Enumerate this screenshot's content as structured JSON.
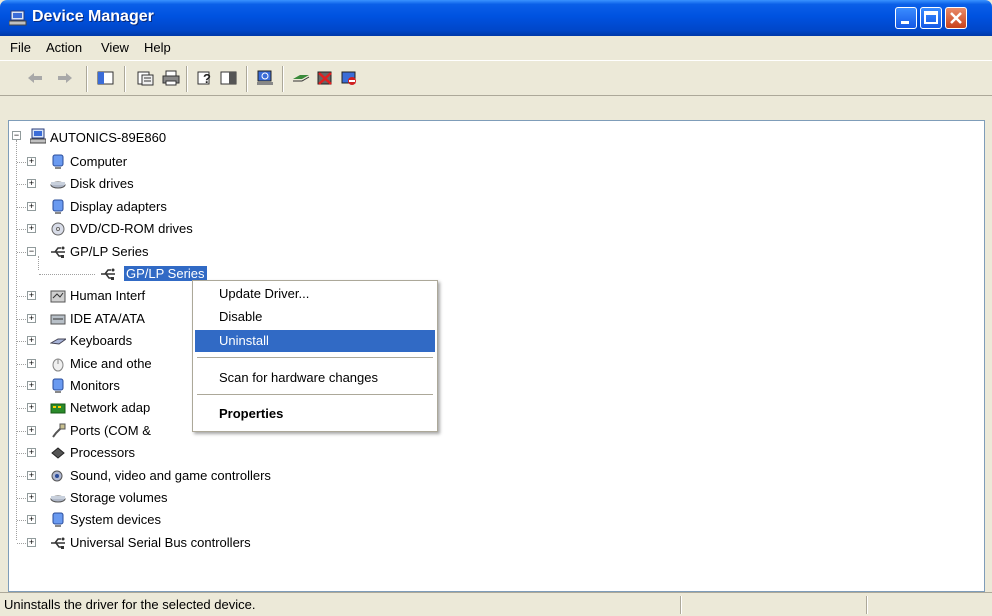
{
  "window": {
    "title": "Device Manager"
  },
  "menu": [
    "File",
    "Action",
    "View",
    "Help"
  ],
  "toolbar": {
    "items": [
      "back-icon",
      "forward-icon",
      "tree-view-icon",
      "properties-icon",
      "print-icon",
      "help-icon",
      "console-icon",
      "scan-hardware-icon",
      "update-driver-icon",
      "uninstall-icon",
      "disable-icon"
    ]
  },
  "tree": {
    "root": "AUTONICS-89E860",
    "items": [
      {
        "label": "Computer",
        "icon": "computer-icon"
      },
      {
        "label": "Disk drives",
        "icon": "disk-drive-icon"
      },
      {
        "label": "Display adapters",
        "icon": "display-adapter-icon"
      },
      {
        "label": "DVD/CD-ROM drives",
        "icon": "dvd-icon"
      },
      {
        "label": "GP/LP Series",
        "icon": "usb-icon",
        "expanded": true
      },
      {
        "label": "GP/LP Series",
        "icon": "usb-icon",
        "child": true,
        "selected": true
      },
      {
        "label": "Human Interf",
        "icon": "hid-icon"
      },
      {
        "label": "IDE ATA/ATA",
        "icon": "ide-icon"
      },
      {
        "label": "Keyboards",
        "icon": "keyboard-icon"
      },
      {
        "label": "Mice and othe",
        "icon": "mouse-icon"
      },
      {
        "label": "Monitors",
        "icon": "monitor-icon"
      },
      {
        "label": "Network adap",
        "icon": "network-icon"
      },
      {
        "label": "Ports (COM &",
        "icon": "port-icon"
      },
      {
        "label": "Processors",
        "icon": "processor-icon"
      },
      {
        "label": "Sound, video and game controllers",
        "icon": "sound-icon"
      },
      {
        "label": "Storage volumes",
        "icon": "storage-icon"
      },
      {
        "label": "System devices",
        "icon": "system-icon"
      },
      {
        "label": "Universal Serial Bus controllers",
        "icon": "usb-icon"
      }
    ]
  },
  "context_menu": {
    "items": [
      "Update Driver...",
      "Disable",
      "Uninstall",
      "Scan for hardware changes",
      "Properties"
    ],
    "highlighted": "Uninstall"
  },
  "status": {
    "text": "Uninstalls the driver for the selected device."
  },
  "colors": {
    "selection": "#316ac5",
    "titlebar": "#0052e0",
    "chrome": "#ece9d8"
  }
}
